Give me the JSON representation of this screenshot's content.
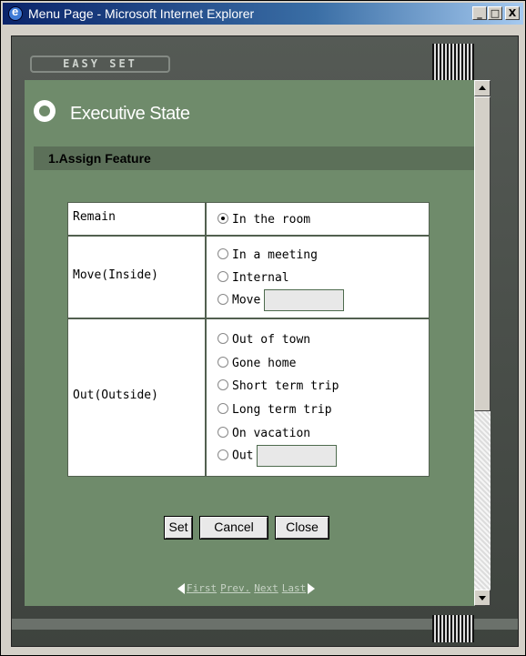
{
  "window": {
    "title": "Menu Page - Microsoft Internet Explorer",
    "minimize": "_",
    "maximize": "□",
    "close": "X"
  },
  "brand": {
    "logo": "EASY SET"
  },
  "header": {
    "title": "Executive State"
  },
  "section": {
    "title": "1.Assign Feature"
  },
  "groups": {
    "remain": {
      "label": "Remain",
      "options": [
        "In the room"
      ],
      "selected": "In the room"
    },
    "move_inside": {
      "label": "Move(Inside)",
      "options": [
        "In a meeting",
        "Internal",
        "Move"
      ],
      "move_input_value": ""
    },
    "out_outside": {
      "label": "Out(Outside)",
      "options": [
        "Out of town",
        "Gone home",
        "Short term trip",
        "Long term trip",
        "On vacation",
        "Out"
      ],
      "out_input_value": ""
    }
  },
  "buttons": {
    "set": "Set",
    "cancel": "Cancel",
    "close": "Close"
  },
  "pager": {
    "first": "First",
    "prev": "Prev.",
    "next": "Next",
    "last": "Last"
  },
  "colors": {
    "content_bg": "#6f8b6b",
    "section_bar": "#5c7059",
    "frame": "#4a4f4a"
  }
}
